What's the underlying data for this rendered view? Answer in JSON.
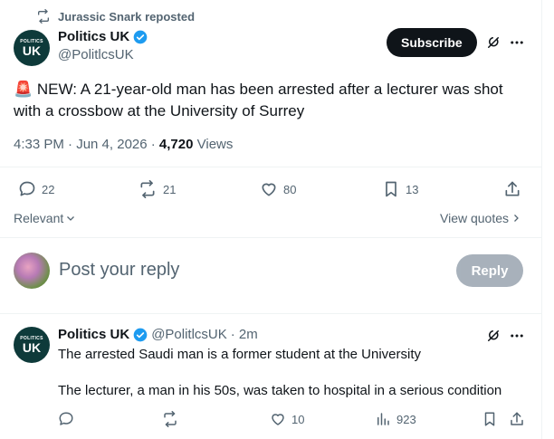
{
  "repost": {
    "label": "Jurassic Snark reposted"
  },
  "tweet": {
    "avatar_text_small": "POLITICS",
    "avatar_text_big": "UK",
    "name": "Politics UK",
    "handle": "@PolitlcsUK",
    "subscribe_label": "Subscribe",
    "emoji": "🚨",
    "text": "NEW: A 21-year-old man has been arrested after a lecturer was shot with a crossbow at the University of Surrey",
    "time": "4:33 PM · Jun 4, 2026 · ",
    "views_count": "4,720",
    "views_label": " Views",
    "replies": "22",
    "reposts": "21",
    "likes": "80",
    "bookmarks": "13"
  },
  "filters": {
    "relevant_label": "Relevant",
    "view_quotes_label": "View quotes"
  },
  "composer": {
    "placeholder": "Post your reply",
    "reply_label": "Reply"
  },
  "reply": {
    "name": "Politics UK",
    "handle": "@PolitlcsUK",
    "time": "· 2m",
    "line1": "The arrested Saudi man is a former student at the University",
    "line2": "The lecturer, a man in his 50s, was taken to hospital in a serious condition",
    "likes": "10",
    "views": "923"
  },
  "colors": {
    "accent": "#1d9bf0",
    "text": "#0f1419",
    "muted": "#536471"
  }
}
